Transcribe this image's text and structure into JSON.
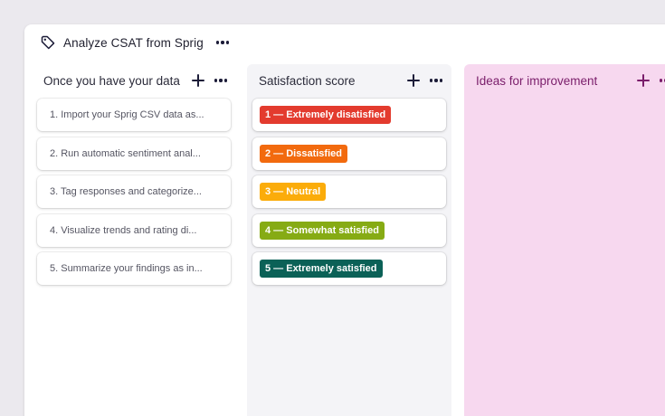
{
  "board": {
    "title": "Analyze CSAT from Sprig",
    "title_icon": "tag-icon"
  },
  "columns": [
    {
      "title": "Once you have your data",
      "cards": [
        "1. Import your Sprig CSV data as...",
        "2. Run automatic sentiment anal...",
        "3. Tag responses and categorize...",
        "4. Visualize trends and rating di...",
        "5. Summarize your findings as in..."
      ]
    },
    {
      "title": "Satisfaction score",
      "cards": [
        {
          "label": "1 — Extremely disatisfied",
          "color": "#e33b2e"
        },
        {
          "label": "2 — Dissatisfied",
          "color": "#f26a0e"
        },
        {
          "label": "3 — Neutral",
          "color": "#fbac0a"
        },
        {
          "label": "4 — Somewhat satisfied",
          "color": "#86ab14"
        },
        {
          "label": "5 — Extremely satisfied",
          "color": "#0b6157"
        }
      ]
    },
    {
      "title": "Ideas for improvement",
      "cards": []
    }
  ],
  "colors": {
    "background": "#ebe9ee",
    "column_gray": "#f4f4f7",
    "column_pink": "#f7d8ef",
    "accent_purple": "#7a1d6a"
  }
}
